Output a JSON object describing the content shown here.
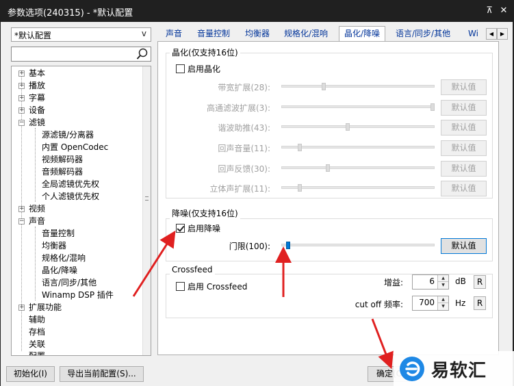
{
  "window": {
    "title": "参数选项(240315) - *默认配置",
    "pin_glyph": "⊼",
    "close_glyph": "✕"
  },
  "profile": {
    "selected": "*默认配置",
    "arrow": "v"
  },
  "search": {
    "value": ""
  },
  "tree": {
    "items": [
      {
        "label": "基本",
        "toggle": "+"
      },
      {
        "label": "播放",
        "toggle": "+"
      },
      {
        "label": "字幕",
        "toggle": "+"
      },
      {
        "label": "设备",
        "toggle": "+"
      },
      {
        "label": "滤镜",
        "toggle": "−"
      },
      {
        "label": "源滤镜/分离器"
      },
      {
        "label": "内置 OpenCodec"
      },
      {
        "label": "视频解码器"
      },
      {
        "label": "音频解码器"
      },
      {
        "label": "全局滤镜优先权"
      },
      {
        "label": "个人滤镜优先权"
      },
      {
        "label": "视频",
        "toggle": "+"
      },
      {
        "label": "声音",
        "toggle": "−"
      },
      {
        "label": "音量控制"
      },
      {
        "label": "均衡器"
      },
      {
        "label": "规格化/混响"
      },
      {
        "label": "晶化/降噪"
      },
      {
        "label": "语言/同步/其他"
      },
      {
        "label": "Winamp DSP 插件"
      },
      {
        "label": "扩展功能",
        "toggle": "+"
      },
      {
        "label": "辅助"
      },
      {
        "label": "存档"
      },
      {
        "label": "关联"
      },
      {
        "label": "配置"
      }
    ]
  },
  "tabs": [
    {
      "label": "声音"
    },
    {
      "label": "音量控制"
    },
    {
      "label": "均衡器"
    },
    {
      "label": "规格化/混响"
    },
    {
      "label": "晶化/降噪",
      "active": true
    },
    {
      "label": "语言/同步/其他"
    },
    {
      "label": "Wi"
    }
  ],
  "crystalize": {
    "group_title": "晶化(仅支持16位)",
    "enable_label": "启用晶化",
    "enabled": false,
    "sliders": [
      {
        "label": "带宽扩展(28):",
        "button": "默认值",
        "level": 0.27
      },
      {
        "label": "高通滤波扩展(3):",
        "button": "默认值",
        "level": 1.0
      },
      {
        "label": "谐波助推(43):",
        "button": "默认值",
        "level": 0.43
      },
      {
        "label": "回声音量(11):",
        "button": "默认值",
        "level": 0.11
      },
      {
        "label": "回声反馈(30):",
        "button": "默认值",
        "level": 0.3
      },
      {
        "label": "立体声扩展(11):",
        "button": "默认值",
        "level": 0.11
      }
    ]
  },
  "denoise": {
    "group_title": "降噪(仅支持16位)",
    "enable_label": "启用降噪",
    "enabled": true,
    "slider_label": "门限(100):",
    "button": "默认值",
    "level": 0.03
  },
  "crossfeed": {
    "group_title": "Crossfeed",
    "enable_label": "启用 Crossfeed",
    "enabled": false,
    "gain_label": "增益:",
    "gain_value": "6",
    "gain_unit": "dB",
    "gain_reset": "R",
    "cutoff_label": "cut off 频率:",
    "cutoff_value": "700",
    "cutoff_unit": "Hz",
    "cutoff_reset": "R"
  },
  "footer": {
    "init_button": "初始化(I)",
    "export_button": "导出当前配置(S)...",
    "ok_button": "确定(O"
  },
  "watermark": {
    "text": "易软汇"
  },
  "colors": {
    "titlebar": "#202020",
    "accent": "#0078d7",
    "annotation_arrow": "#e02020"
  }
}
